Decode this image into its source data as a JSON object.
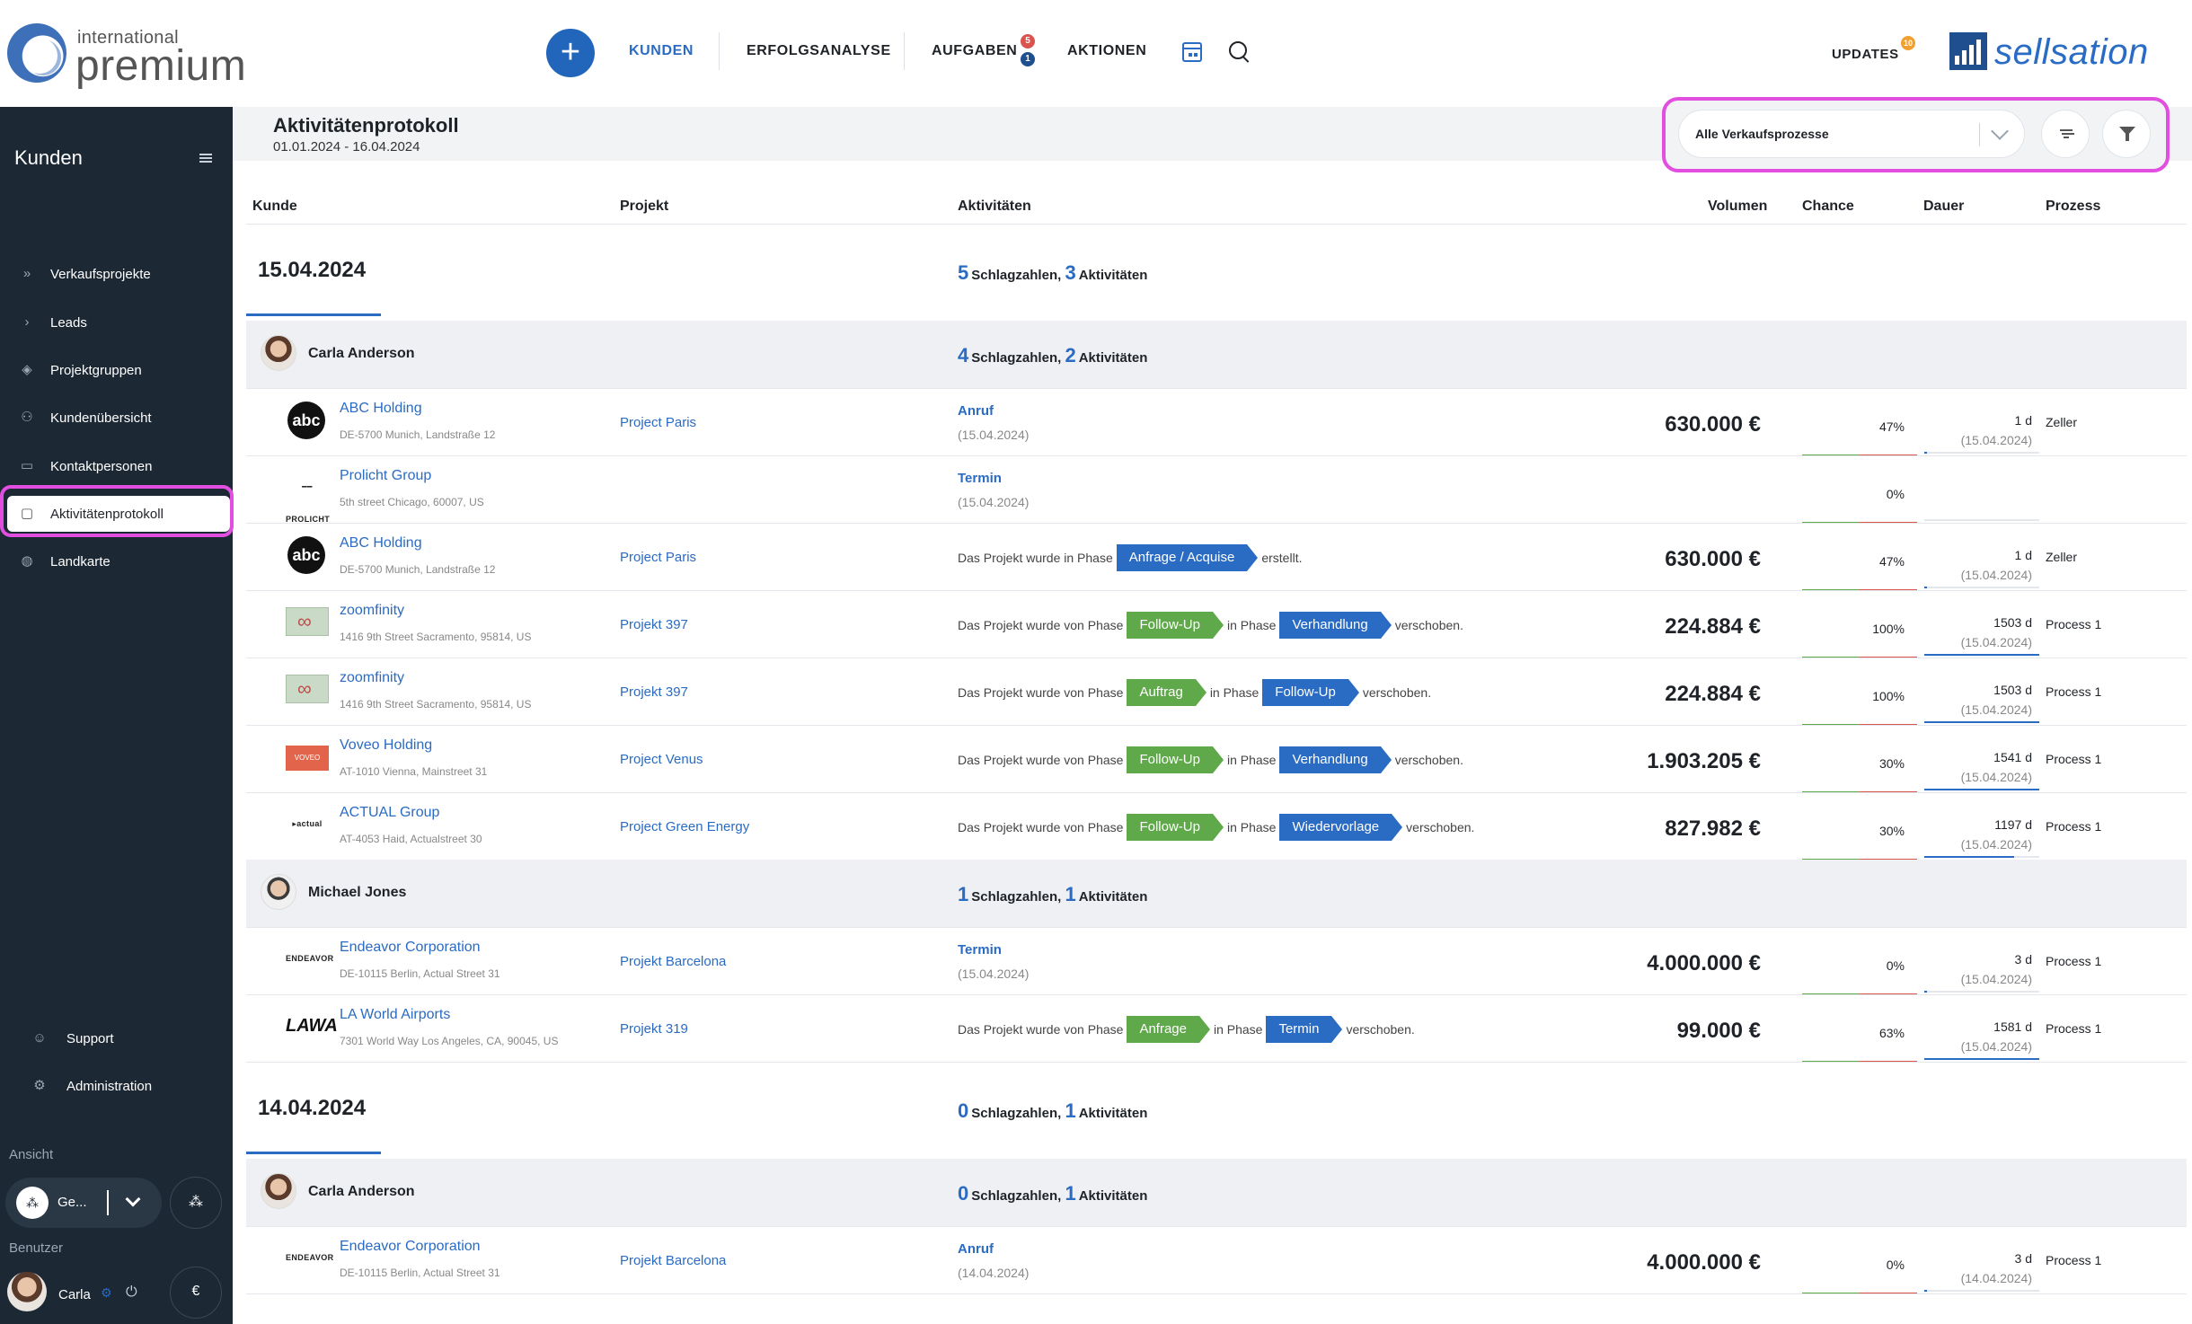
{
  "app": {
    "logo_small": "international",
    "logo_big": "premium",
    "brand": "sellsation"
  },
  "nav": {
    "items": [
      {
        "label": "KUNDEN",
        "active": true
      },
      {
        "label": "ERFOLGSANALYSE"
      },
      {
        "label": "AUFGABEN",
        "badges": [
          "5",
          "1"
        ]
      },
      {
        "label": "AKTIONEN"
      }
    ],
    "updates_label": "UPDATES",
    "updates_badge": "10"
  },
  "sidebar": {
    "title": "Kunden",
    "items": [
      {
        "label": "Verkaufsprojekte",
        "icon": "double-chevron-icon"
      },
      {
        "label": "Leads",
        "icon": "chevron-right-icon"
      },
      {
        "label": "Projektgruppen",
        "icon": "layers-icon"
      },
      {
        "label": "Kundenübersicht",
        "icon": "users-icon"
      },
      {
        "label": "Kontaktpersonen",
        "icon": "contact-card-icon"
      },
      {
        "label": "Aktivitätenprotokoll",
        "icon": "chat-icon",
        "active": true
      },
      {
        "label": "Landkarte",
        "icon": "globe-icon"
      }
    ],
    "support_label": "Support",
    "admin_label": "Administration",
    "view_section": "Ansicht",
    "view_value": "Ge...",
    "user_section": "Benutzer",
    "user_name": "Carla",
    "currency_symbol": "€"
  },
  "page": {
    "title": "Aktivitätenprotokoll",
    "range": "01.01.2024 - 16.04.2024",
    "filter_value": "Alle Verkaufsprozesse"
  },
  "table": {
    "headers": {
      "kunde": "Kunde",
      "projekt": "Projekt",
      "aktivitaeten": "Aktivitäten",
      "volumen": "Volumen",
      "chance": "Chance",
      "dauer": "Dauer",
      "prozess": "Prozess"
    },
    "words": {
      "schlagzahlen": "Schlagzahlen,",
      "aktivitaeten": "Aktivitäten",
      "created_prefix": "Das Projekt wurde in Phase",
      "created_suffix": "erstellt.",
      "moved_prefix": "Das Projekt wurde von Phase",
      "moved_mid": "in Phase",
      "moved_suffix": "verschoben."
    },
    "days": [
      {
        "date": "15.04.2024",
        "schlag": "5",
        "akt": "3",
        "groups": [
          {
            "name": "Carla Anderson",
            "schlag": "4",
            "akt": "2",
            "rows": [
              {
                "company": "ABC Holding",
                "address": "DE-5700 Munich, Landstraße 12",
                "logo": "abc",
                "project": "Project Paris",
                "activity": "Anruf",
                "activity_date": "(15.04.2024)",
                "volume": "630.000 €",
                "chance": "47%",
                "chance_value": 47,
                "duration": "1 d",
                "duration_date": "(15.04.2024)",
                "duration_fill": 0.02,
                "process": "Zeller"
              },
              {
                "company": "Prolicht Group",
                "address": "5th street Chicago, 60007, US",
                "logo": "prolicht",
                "project": "",
                "activity": "Termin",
                "activity_date": "(15.04.2024)",
                "volume": "",
                "chance": "0%",
                "chance_value": 0,
                "duration": "",
                "duration_date": "",
                "duration_fill": 0,
                "process": ""
              },
              {
                "company": "ABC Holding",
                "address": "DE-5700 Munich, Landstraße 12",
                "logo": "abc",
                "project": "Project Paris",
                "phase_created": "Anfrage / Acquise",
                "volume": "630.000 €",
                "chance": "47%",
                "chance_value": 47,
                "duration": "1 d",
                "duration_date": "(15.04.2024)",
                "duration_fill": 0.02,
                "process": "Zeller"
              },
              {
                "company": "zoomfinity",
                "address": "1416 9th Street Sacramento, 95814, US",
                "logo": "zoom",
                "project": "Projekt 397",
                "phase_from": "Follow-Up",
                "phase_to": "Verhandlung",
                "volume": "224.884 €",
                "chance": "100%",
                "chance_value": 100,
                "duration": "1503 d",
                "duration_date": "(15.04.2024)",
                "duration_fill": 1.0,
                "process": "Process 1"
              },
              {
                "company": "zoomfinity",
                "address": "1416 9th Street Sacramento, 95814, US",
                "logo": "zoom",
                "project": "Projekt 397",
                "phase_from": "Auftrag",
                "phase_to": "Follow-Up",
                "volume": "224.884 €",
                "chance": "100%",
                "chance_value": 100,
                "duration": "1503 d",
                "duration_date": "(15.04.2024)",
                "duration_fill": 1.0,
                "process": "Process 1"
              },
              {
                "company": "Voveo Holding",
                "address": "AT-1010 Vienna, Mainstreet 31",
                "logo": "voveo",
                "project": "Project Venus",
                "phase_from": "Follow-Up",
                "phase_to": "Verhandlung",
                "volume": "1.903.205 €",
                "chance": "30%",
                "chance_value": 30,
                "duration": "1541 d",
                "duration_date": "(15.04.2024)",
                "duration_fill": 1.0,
                "process": "Process 1"
              },
              {
                "company": "ACTUAL Group",
                "address": "AT-4053 Haid, Actualstreet 30",
                "logo": "actual",
                "project": "Project Green Energy",
                "phase_from": "Follow-Up",
                "phase_to": "Wiedervorlage",
                "volume": "827.982 €",
                "chance": "30%",
                "chance_value": 30,
                "duration": "1197 d",
                "duration_date": "(15.04.2024)",
                "duration_fill": 0.78,
                "process": "Process 1"
              }
            ]
          },
          {
            "name": "Michael Jones",
            "schlag": "1",
            "akt": "1",
            "rows": [
              {
                "company": "Endeavor Corporation",
                "address": "DE-10115 Berlin, Actual Street 31",
                "logo": "endeavor",
                "project": "Projekt Barcelona",
                "activity": "Termin",
                "activity_date": "(15.04.2024)",
                "volume": "4.000.000 €",
                "chance": "0%",
                "chance_value": 0,
                "duration": "3 d",
                "duration_date": "(15.04.2024)",
                "duration_fill": 0.02,
                "process": "Process 1"
              },
              {
                "company": "LA World Airports",
                "address": "7301 World Way Los Angeles, CA, 90045, US",
                "logo": "lawa",
                "project": "Projekt 319",
                "phase_from": "Anfrage",
                "phase_to": "Termin",
                "volume": "99.000 €",
                "chance": "63%",
                "chance_value": 63,
                "duration": "1581 d",
                "duration_date": "(15.04.2024)",
                "duration_fill": 1.0,
                "process": "Process 1"
              }
            ]
          }
        ]
      },
      {
        "date": "14.04.2024",
        "schlag": "0",
        "akt": "1",
        "groups": [
          {
            "name": "Carla Anderson",
            "schlag": "0",
            "akt": "1",
            "rows": [
              {
                "company": "Endeavor Corporation",
                "address": "DE-10115 Berlin, Actual Street 31",
                "logo": "endeavor",
                "project": "Projekt Barcelona",
                "activity": "Anruf",
                "activity_date": "(14.04.2024)",
                "volume": "4.000.000 €",
                "chance": "0%",
                "chance_value": 0,
                "duration": "3 d",
                "duration_date": "(14.04.2024)",
                "duration_fill": 0.02,
                "process": "Process 1"
              }
            ]
          }
        ]
      }
    ]
  },
  "colors": {
    "accent": "#2a6bc3",
    "sidebar": "#1c2834",
    "highlight": "#e24ee0",
    "phase_green": "#5fa94a",
    "chance_green": "#5fa94a",
    "chance_red": "#d9534f"
  }
}
